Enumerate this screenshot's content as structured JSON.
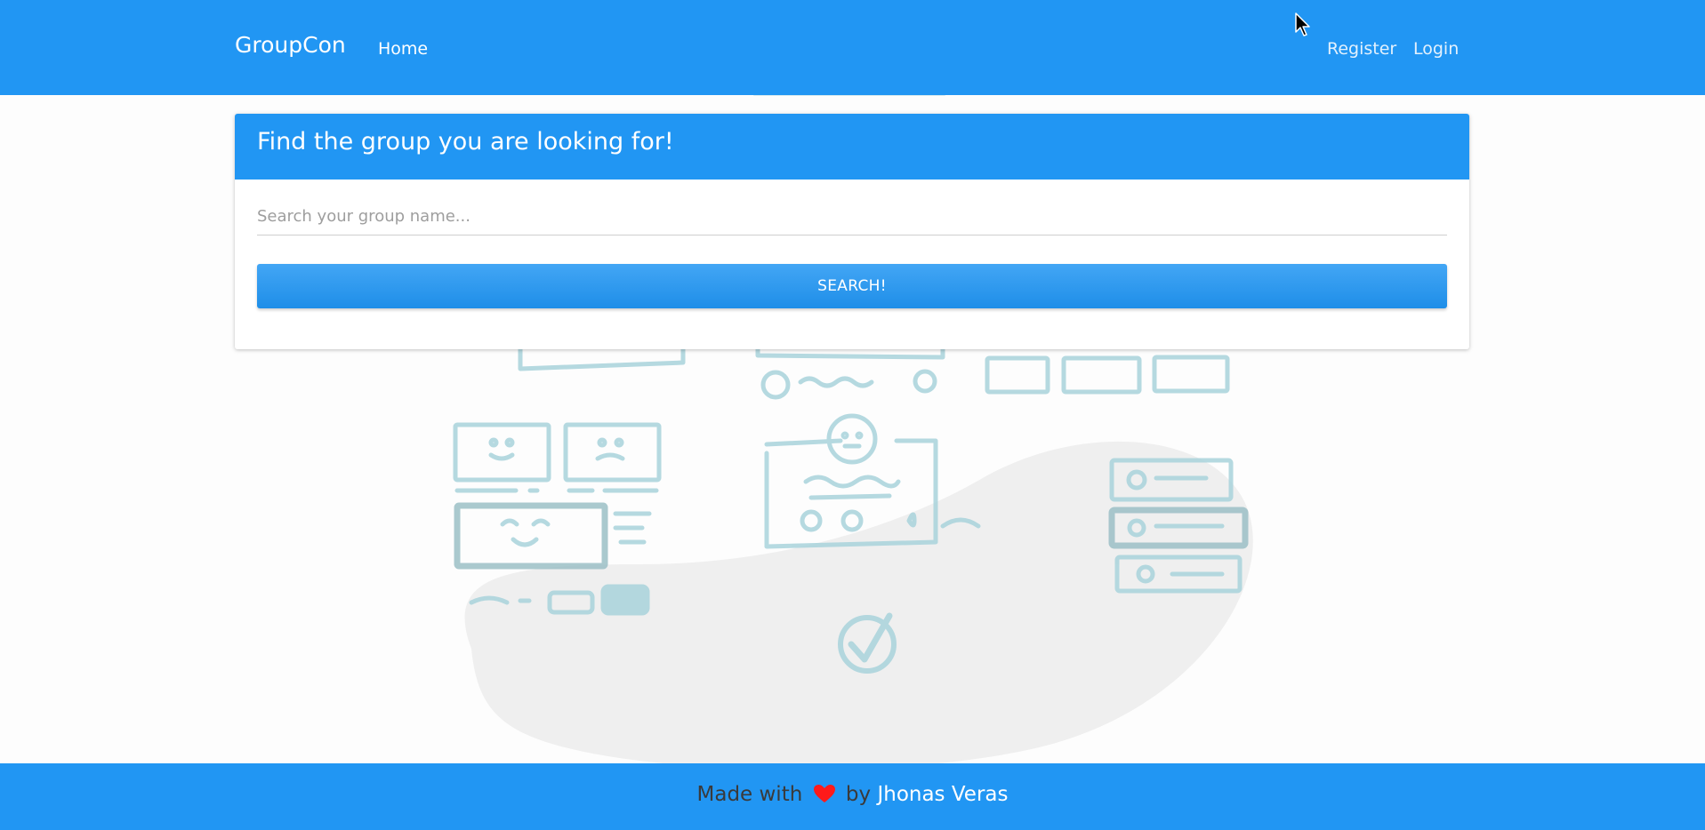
{
  "navbar": {
    "brand": "GroupCon",
    "home_label": "Home",
    "register_label": "Register",
    "login_label": "Login"
  },
  "search_card": {
    "title": "Find the group you are looking for!",
    "input_placeholder": "Search your group name...",
    "input_value": "",
    "button_label": "SEARCH!"
  },
  "footer": {
    "made_with": "Made with",
    "by": "by",
    "author": "Jhonas Veras",
    "heart_icon": "heart-icon"
  },
  "colors": {
    "primary": "#2196f3",
    "heart": "#ff1a1a",
    "footer_text": "#3a3a3a",
    "illustration_stroke": "#a9d3dc",
    "blob": "#efefef"
  }
}
